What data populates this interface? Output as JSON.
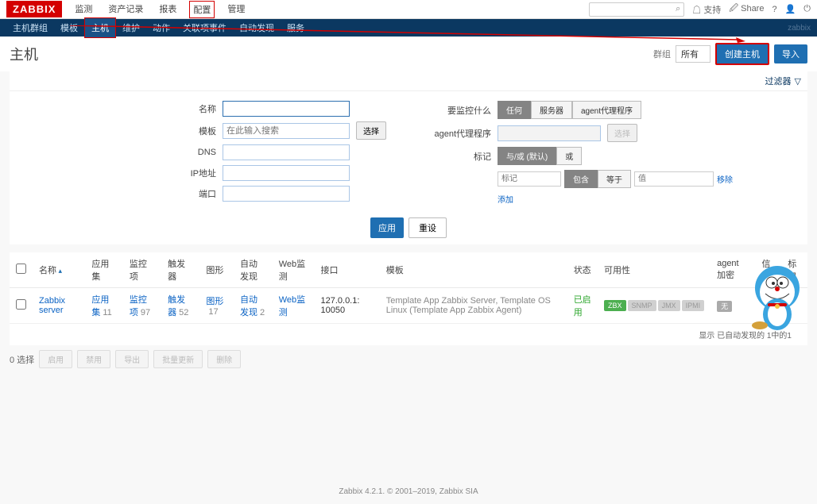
{
  "logo": "ZABBIX",
  "top_nav": {
    "items": [
      "监测",
      "资产记录",
      "报表",
      "配置",
      "管理"
    ],
    "highlight_index": 3,
    "support": "支持",
    "share": "Share"
  },
  "sub_nav": {
    "items": [
      "主机群组",
      "模板",
      "主机",
      "维护",
      "动作",
      "关联项事件",
      "自动发现",
      "服务"
    ],
    "active_index": 2,
    "brand": "zabbix"
  },
  "page": {
    "title": "主机",
    "group_label": "群组",
    "group_value": "所有",
    "btn_create": "创建主机",
    "btn_import": "导入",
    "filter_label": "过滤器"
  },
  "filter": {
    "labels": {
      "name": "名称",
      "template": "模板",
      "dns": "DNS",
      "ip": "IP地址",
      "port": "端口",
      "monitored": "要监控什么",
      "proxy": "agent代理程序",
      "tags": "标记"
    },
    "template_placeholder": "在此输入搜索",
    "btn_select": "选择",
    "monitored_opts": [
      "任何",
      "服务器",
      "agent代理程序"
    ],
    "tag_mode": [
      "与/或 (默认)",
      "或"
    ],
    "tag_op": [
      "标记",
      "包含",
      "等于",
      "值"
    ],
    "tag_remove": "移除",
    "tag_add": "添加",
    "btn_apply": "应用",
    "btn_reset": "重设"
  },
  "table": {
    "headers": [
      "名称",
      "应用集",
      "监控项",
      "触发器",
      "图形",
      "自动发现",
      "Web监测",
      "接口",
      "模板",
      "状态",
      "可用性",
      "agent 加密",
      "信息",
      "标记"
    ],
    "rows": [
      {
        "name": "Zabbix server",
        "apps": {
          "label": "应用集",
          "count": 11
        },
        "items": {
          "label": "监控项",
          "count": 97
        },
        "triggers": {
          "label": "触发器",
          "count": 52
        },
        "graphs": {
          "label": "图形",
          "count": 17
        },
        "discovery": {
          "label": "自动发现",
          "count": 2
        },
        "web": {
          "label": "Web监测",
          "count": ""
        },
        "interface": "127.0.0.1: 10050",
        "templates": "Template App Zabbix Server, Template OS Linux (Template App Zabbix Agent)",
        "status": "已启用",
        "avail": [
          "ZBX",
          "SNMP",
          "JMX",
          "IPMI"
        ],
        "encryption": "无"
      }
    ],
    "foot": "显示 已自动发现的 1中的1"
  },
  "bulk": {
    "count_label": "0 选择",
    "buttons": [
      "启用",
      "禁用",
      "导出",
      "批量更新",
      "删除"
    ]
  },
  "footer": "Zabbix 4.2.1. © 2001–2019, Zabbix SIA"
}
